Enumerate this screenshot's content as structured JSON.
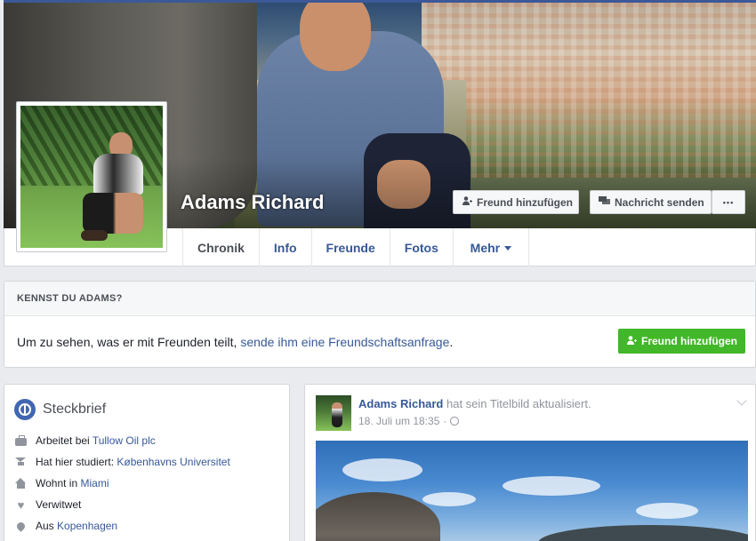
{
  "profile": {
    "name": "Adams Richard"
  },
  "cover_actions": {
    "add_friend": "Freund hinzufügen",
    "send_message": "Nachricht senden",
    "more": "•••"
  },
  "nav": {
    "tabs": [
      {
        "label": "Chronik"
      },
      {
        "label": "Info"
      },
      {
        "label": "Freunde"
      },
      {
        "label": "Fotos"
      },
      {
        "label": "Mehr"
      }
    ]
  },
  "know_box": {
    "heading": "KENNST DU ADAMS?",
    "text_before": "Um zu sehen, was er mit Freunden teilt,",
    "link": "sende ihm eine Freundschaftsanfrage",
    "text_after": ".",
    "button": "Freund hinzufügen"
  },
  "intro": {
    "title": "Steckbrief",
    "items": [
      {
        "icon": "briefcase-icon",
        "prefix": "Arbeitet bei",
        "link": "Tullow Oil plc"
      },
      {
        "icon": "graduation-cap-icon",
        "prefix": "Hat hier studiert:",
        "link": "Københavns Universitet"
      },
      {
        "icon": "home-icon",
        "prefix": "Wohnt in",
        "link": "Miami"
      },
      {
        "icon": "heart-icon",
        "prefix": "Verwitwet",
        "link": ""
      },
      {
        "icon": "location-pin-icon",
        "prefix": "Aus",
        "link": "Kopenhagen"
      }
    ]
  },
  "post": {
    "author": "Adams Richard",
    "action": "hat sein Titelbild aktualisiert.",
    "date": "18. Juli um 18:35",
    "separator": "·"
  },
  "colors": {
    "link": "#365899",
    "accent_green": "#42b72a",
    "brand_blue": "#3b5998",
    "background": "#e9ebee"
  }
}
